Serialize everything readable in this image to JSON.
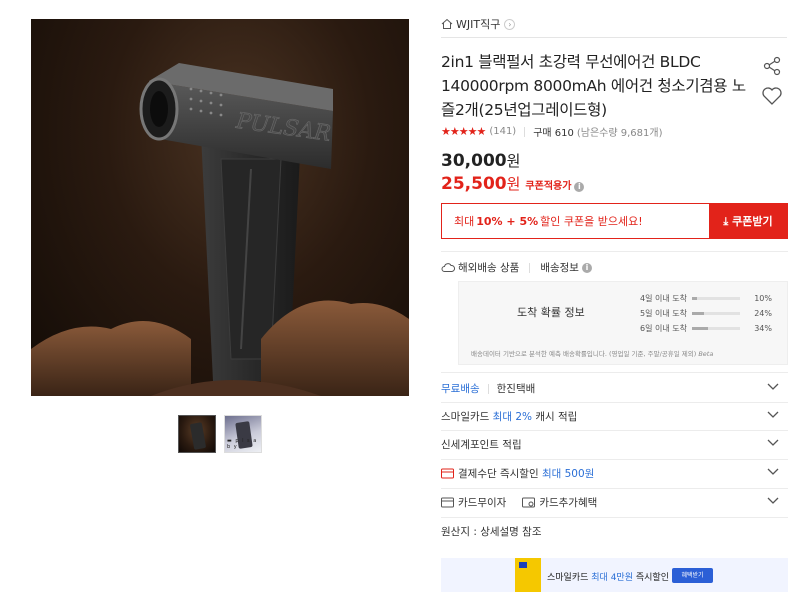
{
  "product_image": {
    "brand_text": "PULSAR"
  },
  "thumbnails": [
    {
      "caption": ""
    },
    {
      "caption": "▬ p l s a  b y"
    }
  ],
  "seller": {
    "name": "WJIT직구"
  },
  "title": "2in1 블랙펄서 초강력 무선에어건 BLDC 140000rpm 8000mAh 에어건 청소기겸용 노즐2개(25년업그레이드형)",
  "rating": {
    "stars": "★★★★★",
    "value": 4.5,
    "count_text": "(141)",
    "purchase_text": "구매 610",
    "stock_text": "(남은수량 9,681개)"
  },
  "price": {
    "original_amount": "30,000",
    "original_unit": "원",
    "sale_amount": "25,500",
    "sale_unit": "원",
    "sale_label": "쿠폰적용가",
    "info_icon": "i"
  },
  "coupon": {
    "message_prefix": "최대",
    "message_bold": "10% + 5%",
    "message_suffix": "할인 쿠폰을 받으세요!",
    "button_label": "⤓ 쿠폰받기"
  },
  "shipping": {
    "overseas_label": "해외배송 상품",
    "info_label": "배송정보",
    "prob_title": "도착 확률 정보",
    "rows": [
      {
        "label": "4일 이내 도착",
        "percent": 10,
        "percent_text": "10%"
      },
      {
        "label": "5일 이내 도착",
        "percent": 24,
        "percent_text": "24%"
      },
      {
        "label": "6일 이내 도착",
        "percent": 34,
        "percent_text": "34%"
      }
    ],
    "note": "배송데이터 기반으로 분석한 예측 배송확률입니다. (영업일 기준, 주말/공휴일 제외)",
    "beta": "Beta"
  },
  "options": {
    "free_shipping": "무료배송",
    "courier": "한진택배",
    "smile_card_prefix": "스마일카드",
    "smile_card_highlight": "최대 2%",
    "smile_card_suffix": "캐시 적립",
    "shinsegae": "신세계포인트 적립",
    "payment_prefix": "결제수단 즉시할인",
    "payment_highlight": "최대 500원",
    "card_interest": "카드무이자",
    "card_benefit": "카드추가혜택",
    "origin": "원산지 : 상세설명 참조"
  },
  "banner": {
    "text_prefix": "스마일카드",
    "text_highlight": "최대 4만원",
    "text_suffix": "즉시할인",
    "button_label": "혜택받기"
  },
  "colors": {
    "accent_red": "#e2231a",
    "link_blue": "#2b6fd6"
  }
}
